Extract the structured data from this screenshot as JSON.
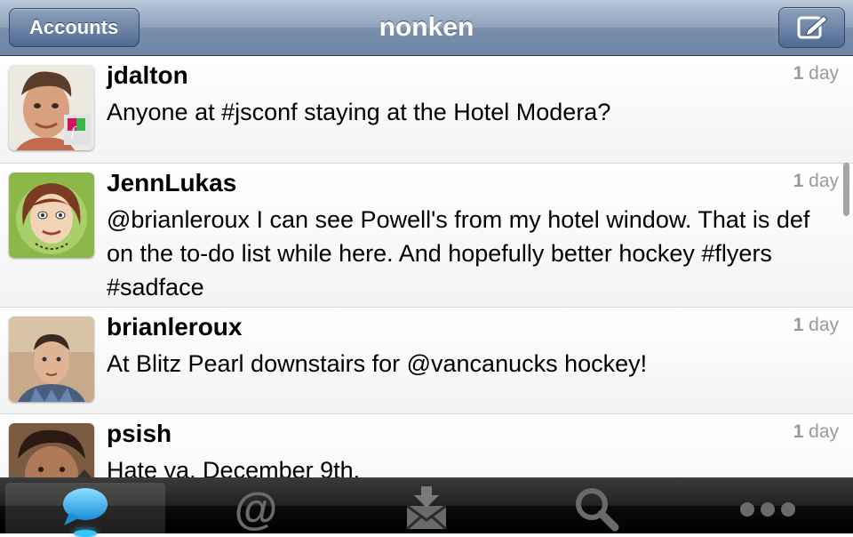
{
  "navbar": {
    "title": "nonken",
    "back_label": "Accounts",
    "compose_icon": "compose-icon"
  },
  "tweets": [
    {
      "username": "jdalton",
      "text": "Anyone at #jsconf staying at the Hotel Modera?",
      "time_num": "1",
      "time_unit": "day"
    },
    {
      "username": "JennLukas",
      "text": "@brianleroux I can see Powell's from my hotel window. That is def on the to-do list while here. And hopefully better hockey #flyers #sadface",
      "time_num": "1",
      "time_unit": "day"
    },
    {
      "username": "brianleroux",
      "text": "At Blitz Pearl downstairs for @vancanucks hockey!",
      "time_num": "1",
      "time_unit": "day"
    },
    {
      "username": "psish",
      "text": "Hate ya, December 9th.",
      "time_num": "1",
      "time_unit": "day"
    }
  ],
  "tabbar": {
    "tabs": [
      {
        "icon": "speech-bubble-icon",
        "active": true
      },
      {
        "icon": "at-sign-icon",
        "active": false
      },
      {
        "icon": "inbox-icon",
        "active": false
      },
      {
        "icon": "search-icon",
        "active": false
      },
      {
        "icon": "more-icon",
        "active": false
      }
    ],
    "accent_color": "#35c5ff"
  }
}
